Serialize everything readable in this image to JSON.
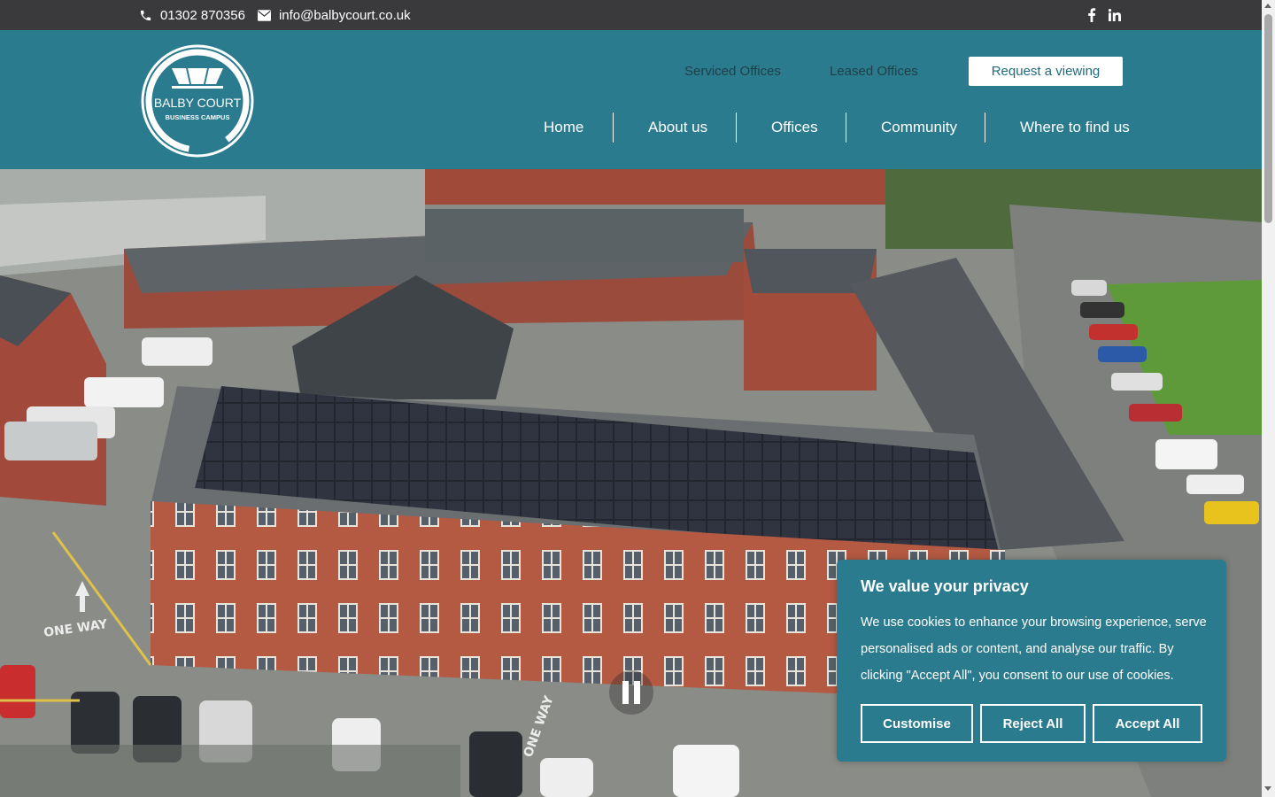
{
  "topbar": {
    "phone": "01302 870356",
    "email": "info@balbycourt.co.uk",
    "social": [
      "facebook-icon",
      "linkedin-icon"
    ]
  },
  "logo": {
    "line1": "BALBY COURT",
    "line2": "BUSINESS CAMPUS"
  },
  "utility_nav": {
    "serviced": "Serviced Offices",
    "leased": "Leased Offices",
    "cta": "Request a viewing"
  },
  "main_nav": [
    {
      "label": "Home"
    },
    {
      "label": "About us"
    },
    {
      "label": "Offices"
    },
    {
      "label": "Community"
    },
    {
      "label": "Where to find us"
    }
  ],
  "hero": {
    "road_markings": [
      "ONE WAY",
      "ONE WAY"
    ],
    "control": "pause-icon"
  },
  "cookie": {
    "title": "We value your privacy",
    "body": "We use cookies to enhance your browsing experience, serve personalised ads or content, and analyse our traffic. By clicking \"Accept All\", you consent to our use of cookies.",
    "customise": "Customise",
    "reject": "Reject All",
    "accept": "Accept All"
  },
  "colors": {
    "brand_teal": "#2b7b8f",
    "topbar": "#3a3a3c"
  }
}
